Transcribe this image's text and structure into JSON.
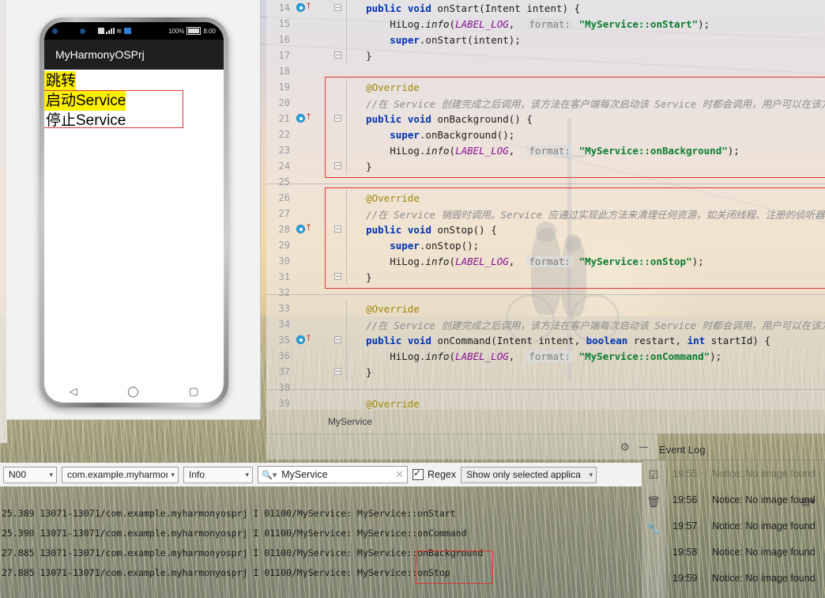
{
  "previewer": {
    "phone": {
      "status_bar": {
        "battery": "100%",
        "time": "8:00"
      },
      "app_title": "MyHarmonyOSPrj",
      "buttons": [
        {
          "label": "跳转",
          "highlighted": true
        },
        {
          "label": "启动Service",
          "highlighted": true
        },
        {
          "label": "停止Service",
          "highlighted": false
        }
      ],
      "nav": {
        "back": "◁",
        "home": "◯",
        "recent": "▢"
      }
    }
  },
  "editor": {
    "breadcrumb": "MyService",
    "lines": [
      {
        "n": "14",
        "marker": true,
        "fold": "minus",
        "text": "    public void onStart(Intent intent) {"
      },
      {
        "n": "15",
        "marker": false,
        "fold": "",
        "text": "        HiLog.info(LABEL_LOG,  format: \"MyService::onStart\");"
      },
      {
        "n": "16",
        "marker": false,
        "fold": "",
        "text": "        super.onStart(intent);"
      },
      {
        "n": "17",
        "marker": false,
        "fold": "plus",
        "text": "    }"
      },
      {
        "n": "18",
        "marker": false,
        "fold": "",
        "text": ""
      },
      {
        "n": "19",
        "marker": false,
        "fold": "",
        "text": "    @Override"
      },
      {
        "n": "20",
        "marker": false,
        "fold": "",
        "text": "    //在 Service 创建完成之后调用，该方法在客户端每次启动该 Service 时都会调用，用户可以在该方法"
      },
      {
        "n": "21",
        "marker": true,
        "fold": "minus",
        "text": "    public void onBackground() {"
      },
      {
        "n": "22",
        "marker": false,
        "fold": "",
        "text": "        super.onBackground();"
      },
      {
        "n": "23",
        "marker": false,
        "fold": "",
        "text": "        HiLog.info(LABEL_LOG,  format: \"MyService::onBackground\");"
      },
      {
        "n": "24",
        "marker": false,
        "fold": "plus",
        "text": "    }"
      },
      {
        "n": "25",
        "marker": false,
        "fold": "",
        "text": ""
      },
      {
        "n": "26",
        "marker": false,
        "fold": "",
        "text": "    @Override"
      },
      {
        "n": "27",
        "marker": false,
        "fold": "",
        "text": "    //在 Service 销毁时调用。Service 应通过实现此方法来清理任何资源，如关闭线程、注册的侦听器等。"
      },
      {
        "n": "28",
        "marker": true,
        "fold": "minus",
        "text": "    public void onStop() {"
      },
      {
        "n": "29",
        "marker": false,
        "fold": "",
        "text": "        super.onStop();"
      },
      {
        "n": "30",
        "marker": false,
        "fold": "",
        "text": "        HiLog.info(LABEL_LOG,  format: \"MyService::onStop\");"
      },
      {
        "n": "31",
        "marker": false,
        "fold": "plus",
        "text": "    }"
      },
      {
        "n": "32",
        "marker": false,
        "fold": "",
        "text": ""
      },
      {
        "n": "33",
        "marker": false,
        "fold": "",
        "text": "    @Override"
      },
      {
        "n": "34",
        "marker": false,
        "fold": "",
        "text": "    //在 Service 创建完成之后调用，该方法在客户端每次启动该 Service 时都会调用，用户可以在该方法"
      },
      {
        "n": "35",
        "marker": true,
        "fold": "minus",
        "text": "    public void onCommand(Intent intent, boolean restart, int startId) {"
      },
      {
        "n": "36",
        "marker": false,
        "fold": "",
        "text": "        HiLog.info(LABEL_LOG,  format: \"MyService::onCommand\");"
      },
      {
        "n": "37",
        "marker": false,
        "fold": "plus",
        "text": "    }"
      },
      {
        "n": "38",
        "marker": false,
        "fold": "",
        "text": ""
      },
      {
        "n": "39",
        "marker": false,
        "fold": "",
        "text": "    @Override"
      }
    ]
  },
  "logcat": {
    "device_combo": "N00",
    "process_combo": "com.example.myharmonyo",
    "level_combo": "Info",
    "search_value": "MyService",
    "search_placeholder": "MyService",
    "regex_label": "Regex",
    "regex_checked": true,
    "scope_combo": "Show only selected applica",
    "lines": [
      "25.389 13071-13071/com.example.myharmonyosprj I 01100/MyService: MyService::onStart",
      "25.390 13071-13071/com.example.myharmonyosprj I 01100/MyService: MyService::onCommand",
      "27.885 13071-13071/com.example.myharmonyosprj I 01100/MyService: MyService::onBackground",
      "27.885 13071-13071/com.example.myharmonyosprj I 01100/MyService: MyService::onStop"
    ]
  },
  "event_log": {
    "title": "Event Log",
    "rows": [
      {
        "time": "19:55",
        "message": "Notice: No image found",
        "faded": true
      },
      {
        "time": "19:56",
        "message": "Notice: No image found",
        "faded": false
      },
      {
        "time": "19:57",
        "message": "Notice: No image found",
        "faded": false
      },
      {
        "time": "19:58",
        "message": "Notice: No image found",
        "faded": false
      },
      {
        "time": "19:59",
        "message": "Notice: No image found",
        "faded": false
      }
    ]
  },
  "colors": {
    "keyword": "#0033b3",
    "string": "#0a7c2f",
    "annotation": "#9e880d",
    "comment": "#8c8c8c",
    "field": "#871094",
    "highlight_box": "#e03535",
    "button_highlight": "#ffef00"
  }
}
